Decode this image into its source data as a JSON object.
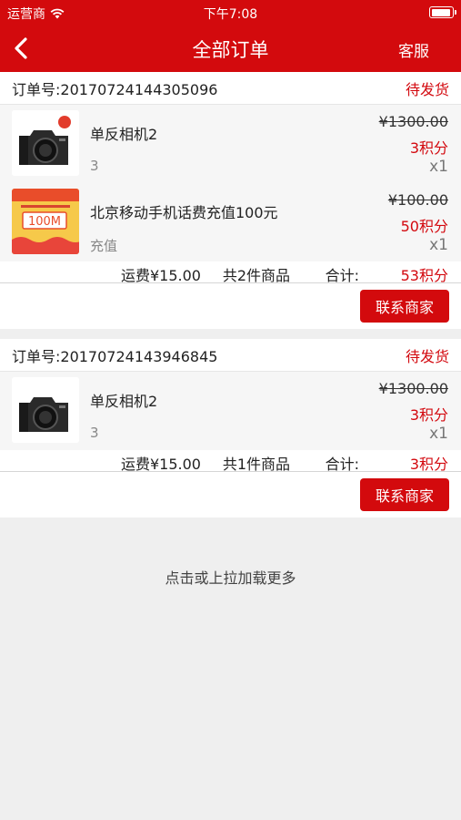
{
  "status_bar": {
    "carrier": "运营商",
    "time": "下午7:08"
  },
  "nav": {
    "title": "全部订单",
    "service_label": "客服"
  },
  "orders": [
    {
      "order_no_label": "订单号:20170724144305096",
      "status": "待发货",
      "items": [
        {
          "name": "单反相机2",
          "spec": "3",
          "old_price": "¥1300.00",
          "points": "3积分",
          "qty": "x1",
          "thumb": "camera"
        },
        {
          "name": "北京移动手机话费充值100元",
          "spec": "充值",
          "old_price": "¥100.00",
          "points": "50积分",
          "qty": "x1",
          "thumb": "recharge",
          "thumb_text": "100M"
        }
      ],
      "freight": "运费¥15.00",
      "count": "共2件商品",
      "total_label": "合计:",
      "total": "53积分",
      "contact_label": "联系商家"
    },
    {
      "order_no_label": "订单号:20170724143946845",
      "status": "待发货",
      "items": [
        {
          "name": "单反相机2",
          "spec": "3",
          "old_price": "¥1300.00",
          "points": "3积分",
          "qty": "x1",
          "thumb": "camera"
        }
      ],
      "freight": "运费¥15.00",
      "count": "共1件商品",
      "total_label": "合计:",
      "total": "3积分",
      "contact_label": "联系商家"
    }
  ],
  "load_more": "点击或上拉加载更多",
  "colors": {
    "brand_red": "#d30a0d",
    "price_red": "#d3090f",
    "background": "#efefef"
  }
}
